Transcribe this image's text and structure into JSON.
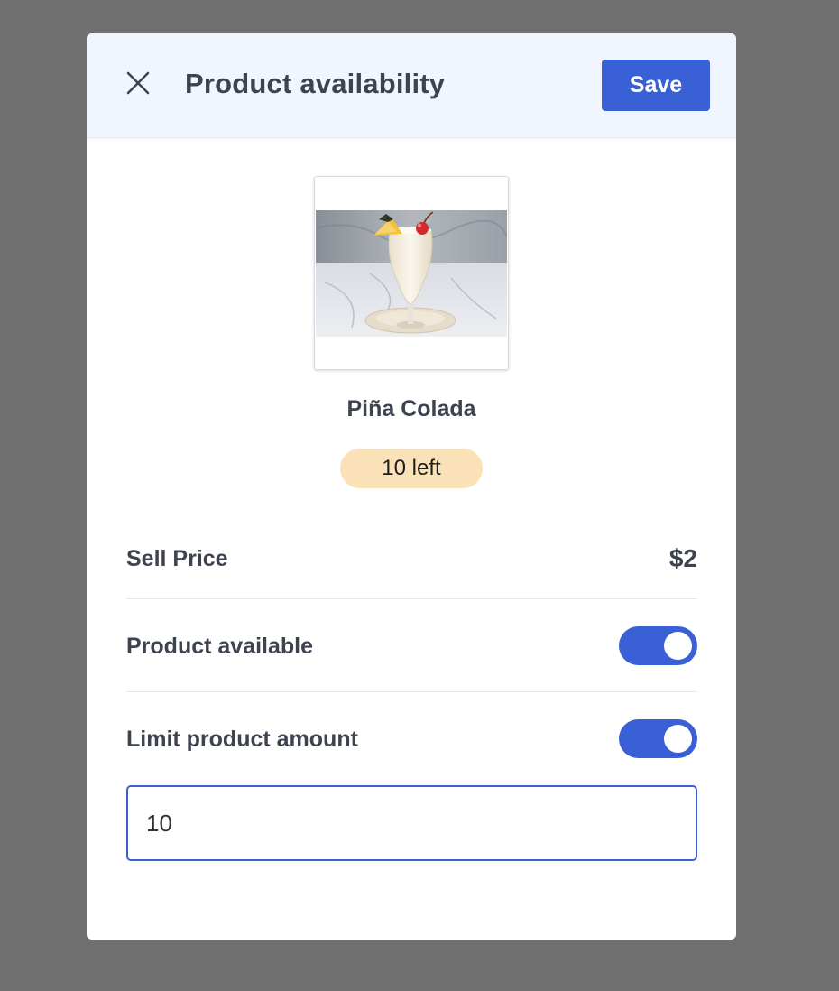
{
  "modal": {
    "title": "Product availability",
    "save_label": "Save"
  },
  "product": {
    "name": "Piña Colada",
    "stock_badge": "10 left",
    "image_icon": "pina-colada-photo"
  },
  "fields": {
    "sell_price_label": "Sell Price",
    "sell_price_value": "$2",
    "available_label": "Product available",
    "available_on": true,
    "limit_label": "Limit product amount",
    "limit_on": true,
    "limit_amount_value": "10"
  },
  "colors": {
    "accent": "#3a60d6",
    "badge_bg": "#fbe1b7",
    "overlay": "#707070"
  }
}
